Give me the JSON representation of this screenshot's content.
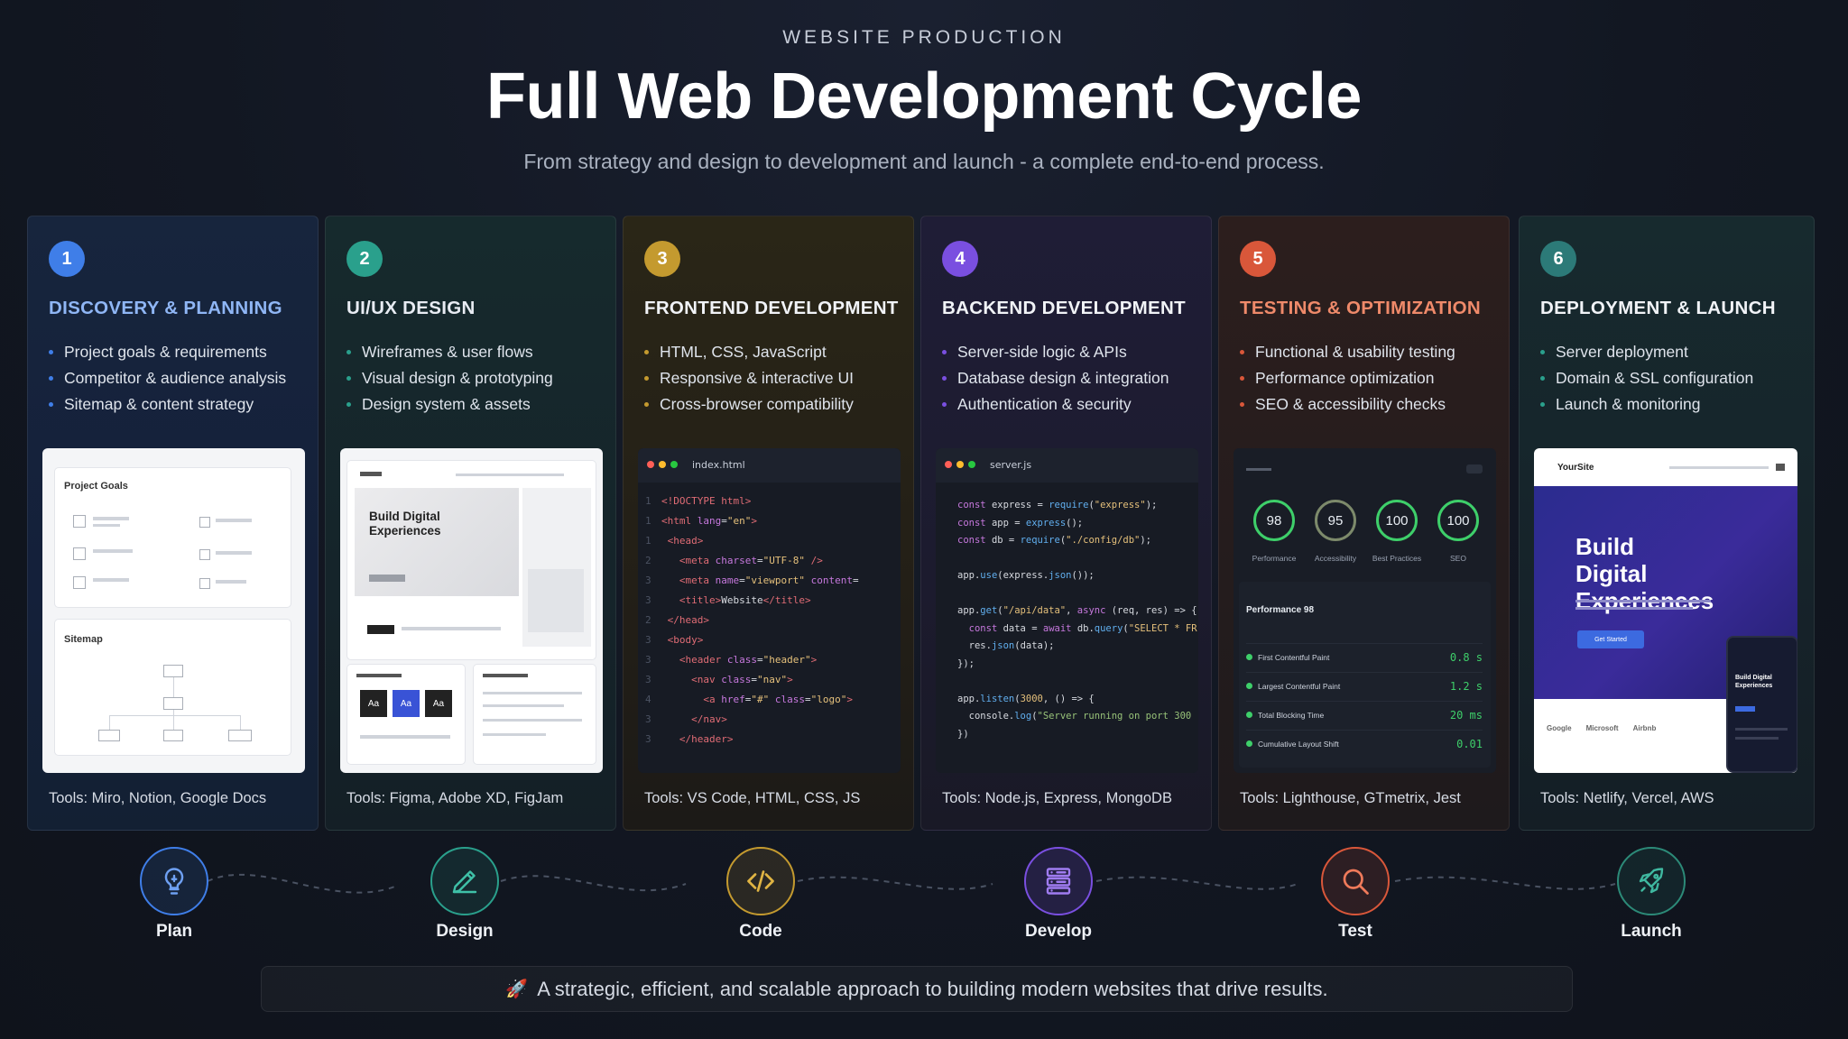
{
  "header": {
    "eyebrow": "WEBSITE PRODUCTION",
    "title": "Full Web Development Cycle",
    "subtitle": "From strategy and design to development and launch - a complete end-to-end process."
  },
  "cards": [
    {
      "number": "1",
      "accent": "#3f7ee8",
      "title_color": "#8fb6f5",
      "title": "DISCOVERY & PLANNING",
      "items": [
        "Project goals & requirements",
        "Competitor & audience analysis",
        "Sitemap & content strategy"
      ],
      "tools": "Tools: Miro, Notion, Google Docs",
      "mock": {
        "panel1": "Project Goals",
        "panel2": "Sitemap"
      }
    },
    {
      "number": "2",
      "accent": "#2aa08c",
      "title_color": "#e8ecf3",
      "title": "UI/UX DESIGN",
      "items": [
        "Wireframes & user flows",
        "Visual design & prototyping",
        "Design system & assets"
      ],
      "tools": "Tools: Figma, Adobe XD, FigJam",
      "mock": {
        "hero": "Build Digital Experiences",
        "swatch_labels": [
          "Aa",
          "Aa",
          "Aa"
        ]
      }
    },
    {
      "number": "3",
      "accent": "#c49a2f",
      "title_color": "#f1f3f7",
      "title": "FRONTEND DEVELOPMENT",
      "items": [
        "HTML, CSS, JavaScript",
        "Responsive & interactive UI",
        "Cross-browser compatibility"
      ],
      "tools": "Tools: VS Code, HTML, CSS, JS",
      "mock": {
        "filename": "index.html"
      }
    },
    {
      "number": "4",
      "accent": "#7a4fe0",
      "title_color": "#f1f3f7",
      "title": "BACKEND DEVELOPMENT",
      "items": [
        "Server-side logic & APIs",
        "Database design & integration",
        "Authentication & security"
      ],
      "tools": "Tools: Node.js, Express, MongoDB",
      "mock": {
        "filename": "server.js"
      }
    },
    {
      "number": "5",
      "accent": "#d9573a",
      "title_color": "#ef8a6a",
      "title": "TESTING & OPTIMIZATION",
      "items": [
        "Functional & usability testing",
        "Performance optimization",
        "SEO & accessibility checks"
      ],
      "tools": "Tools: Lighthouse, GTmetrix, Jest",
      "mock": {
        "scores": [
          {
            "value": "98",
            "label": "Performance"
          },
          {
            "value": "95",
            "label": "Accessibility"
          },
          {
            "value": "100",
            "label": "Best Practices"
          },
          {
            "value": "100",
            "label": "SEO"
          }
        ],
        "perf_label": "Performance 98",
        "metrics": [
          {
            "name": "First Contentful Paint",
            "value": "0.8 s"
          },
          {
            "name": "Largest Contentful Paint",
            "value": "1.2 s"
          },
          {
            "name": "Total Blocking Time",
            "value": "20 ms"
          },
          {
            "name": "Cumulative Layout Shift",
            "value": "0.01"
          }
        ]
      }
    },
    {
      "number": "6",
      "accent": "#2c7a78",
      "title_color": "#f1f3f7",
      "title": "DEPLOYMENT & LAUNCH",
      "items": [
        "Server deployment",
        "Domain & SSL configuration",
        "Launch & monitoring"
      ],
      "tools": "Tools: Netlify, Vercel, AWS",
      "mock": {
        "brand": "YourSite",
        "hero": "Build Digital Experiences",
        "cta": "Get Started",
        "logos": [
          "Google",
          "Microsoft",
          "Airbnb"
        ],
        "phone_hero": "Build Digital Experiences"
      }
    }
  ],
  "stages": [
    {
      "label": "Plan",
      "icon": "lightbulb-icon",
      "color": "#3f7ee8"
    },
    {
      "label": "Design",
      "icon": "pencil-icon",
      "color": "#2aa08c"
    },
    {
      "label": "Code",
      "icon": "code-icon",
      "color": "#c49a2f"
    },
    {
      "label": "Develop",
      "icon": "server-icon",
      "color": "#7a4fe0"
    },
    {
      "label": "Test",
      "icon": "magnifier-icon",
      "color": "#d9573a"
    },
    {
      "label": "Launch",
      "icon": "rocket-icon",
      "color": "#2c8a78"
    }
  ],
  "footer": {
    "text": "A strategic, efficient, and scalable approach to building modern websites that drive results."
  }
}
